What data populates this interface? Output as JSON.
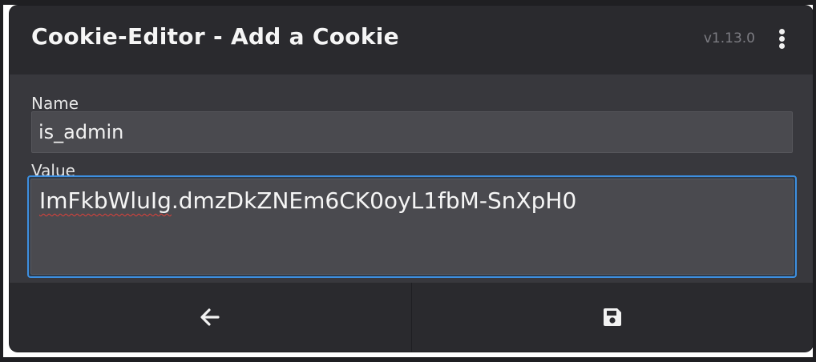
{
  "popup": {
    "title": "Cookie-Editor - Add a Cookie",
    "version": "v1.13.0",
    "menu_icon": "kebab-menu-icon"
  },
  "form": {
    "name_label": "Name",
    "name_value": "is_admin",
    "value_label": "Value",
    "value_misspelled": "ImFkbWluIg",
    "value_rest": ".dmzDkZNEm6CK0oyL1fbM-SnXpH0"
  },
  "footer": {
    "back_icon": "arrow-left-icon",
    "save_icon": "save-icon"
  },
  "colors": {
    "background": "#2a2a2e",
    "form_background": "#38383d",
    "input_background": "#4a4a4f",
    "focus_border": "#3d8fe0",
    "text": "#f5f5f5",
    "muted_text": "#7c7c82"
  }
}
